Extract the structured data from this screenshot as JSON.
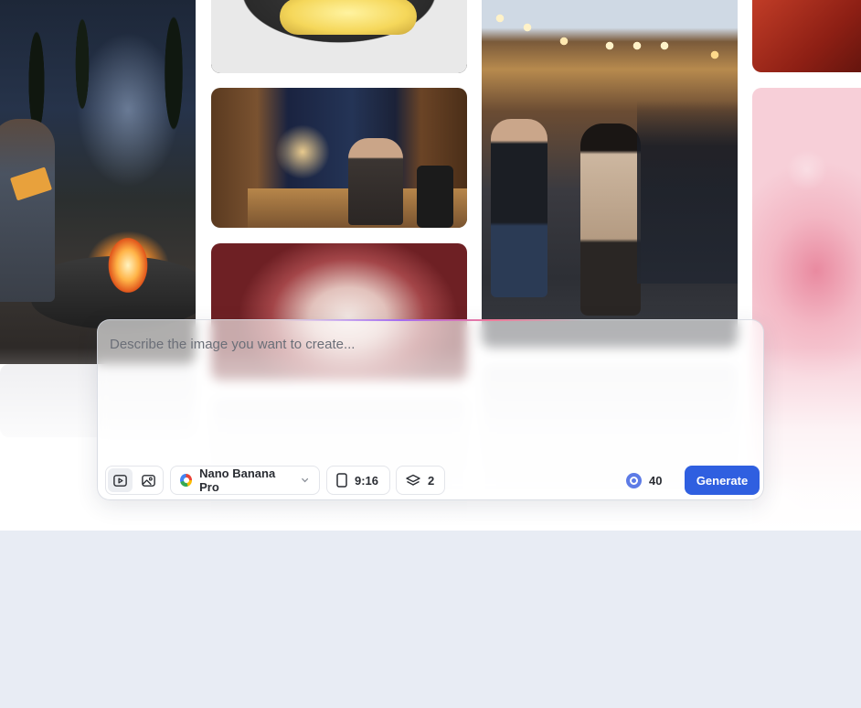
{
  "gallery": {
    "items": [
      {
        "id": "campfire",
        "subject": "person reading by campfire in forest"
      },
      {
        "id": "butter",
        "subject": "butter letters on dark plate"
      },
      {
        "id": "study",
        "subject": "man working at desk in study at night"
      },
      {
        "id": "splash",
        "subject": "red liquid splash"
      },
      {
        "id": "market",
        "subject": "night street market with lanterns"
      },
      {
        "id": "red",
        "subject": "red abstract"
      },
      {
        "id": "pink",
        "subject": "pink bubbles"
      }
    ]
  },
  "prompt": {
    "placeholder": "Describe the image you want to create...",
    "value": ""
  },
  "toolbar": {
    "modes": [
      {
        "name": "video-mode",
        "icon": "video-icon",
        "active": true
      },
      {
        "name": "image-mode",
        "icon": "image-icon",
        "active": false
      }
    ],
    "model": {
      "label": "Nano Banana Pro",
      "icon": "google-icon"
    },
    "aspect_ratio": {
      "label": "9:16",
      "icon": "portrait-frame-icon"
    },
    "image_count": {
      "label": "2",
      "icon": "layers-icon"
    },
    "credits": {
      "value": "40",
      "icon": "credits-icon"
    },
    "generate_label": "Generate"
  },
  "colors": {
    "accent": "#2f5fe0",
    "credit_icon": "#5d7be6",
    "below_fold": "#e8ecf4"
  }
}
